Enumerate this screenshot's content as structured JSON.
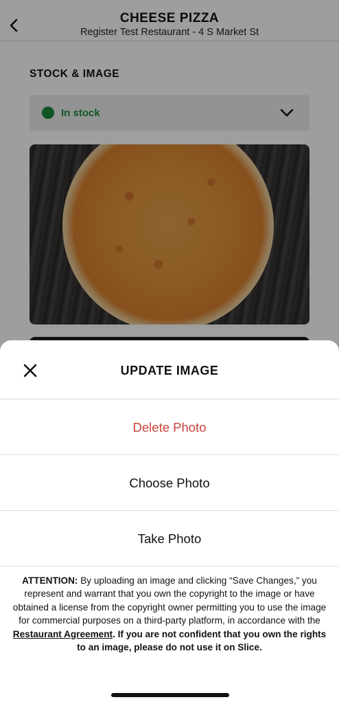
{
  "header": {
    "title": "CHEESE PIZZA",
    "subtitle": "Register Test Restaurant - 4 S Market St",
    "back_icon": "chevron-left-icon"
  },
  "stock_section": {
    "heading": "STOCK & IMAGE",
    "status": "In stock",
    "status_color": "#1a8c3c",
    "dropdown_icon": "chevron-down-icon"
  },
  "sheet": {
    "title": "UPDATE IMAGE",
    "close_icon": "close-icon",
    "options": {
      "delete": "Delete Photo",
      "choose": "Choose Photo",
      "take": "Take Photo"
    },
    "delete_color": "#c8423a",
    "attention": {
      "label": "ATTENTION:",
      "text_before_link": " By uploading an image and clicking “Save Changes,” you represent and warrant that you own the copyright to the image or have obtained a license from the copyright owner permitting you to use the image for commercial purposes on a third-party platform, in accordance with the ",
      "link": "Restaurant Agreement",
      "text_after_link": ". If you are not confident that you own the rights to an image, please do not use it on Slice."
    }
  }
}
